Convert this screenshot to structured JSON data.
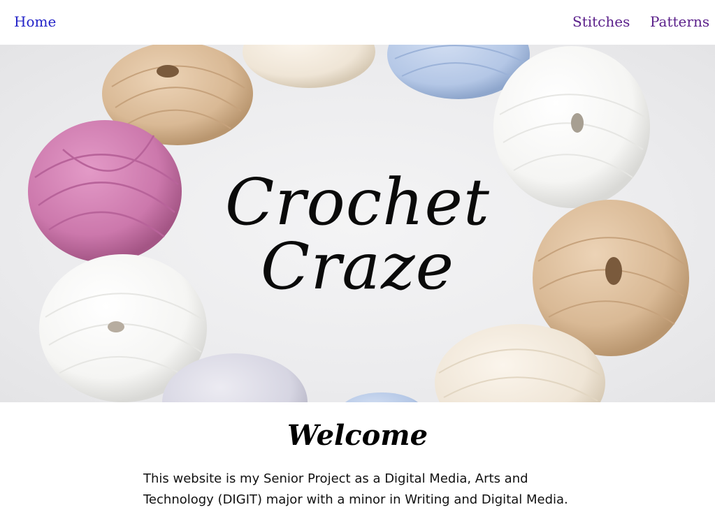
{
  "nav": {
    "home": "Home",
    "stitches": "Stitches",
    "patterns": "Patterns"
  },
  "hero": {
    "title_line1": "Crochet",
    "title_line2": "Craze"
  },
  "welcome": {
    "heading": "Welcome",
    "text_line1": "This website is my Senior Project as a Digital Media, Arts and",
    "text_line2": "Technology (DIGIT) major with a minor in Writing and Digital Media."
  },
  "colors": {
    "nav_home": "#2323c8",
    "nav_links": "#5a1f8a",
    "yarn_pink": "#d27fb4",
    "yarn_tan": "#ddbf9c",
    "yarn_blue": "#b9cbe8",
    "yarn_white": "#f7f7f5",
    "yarn_cream": "#f1e8db",
    "yarn_lilac": "#d8d8e4"
  }
}
